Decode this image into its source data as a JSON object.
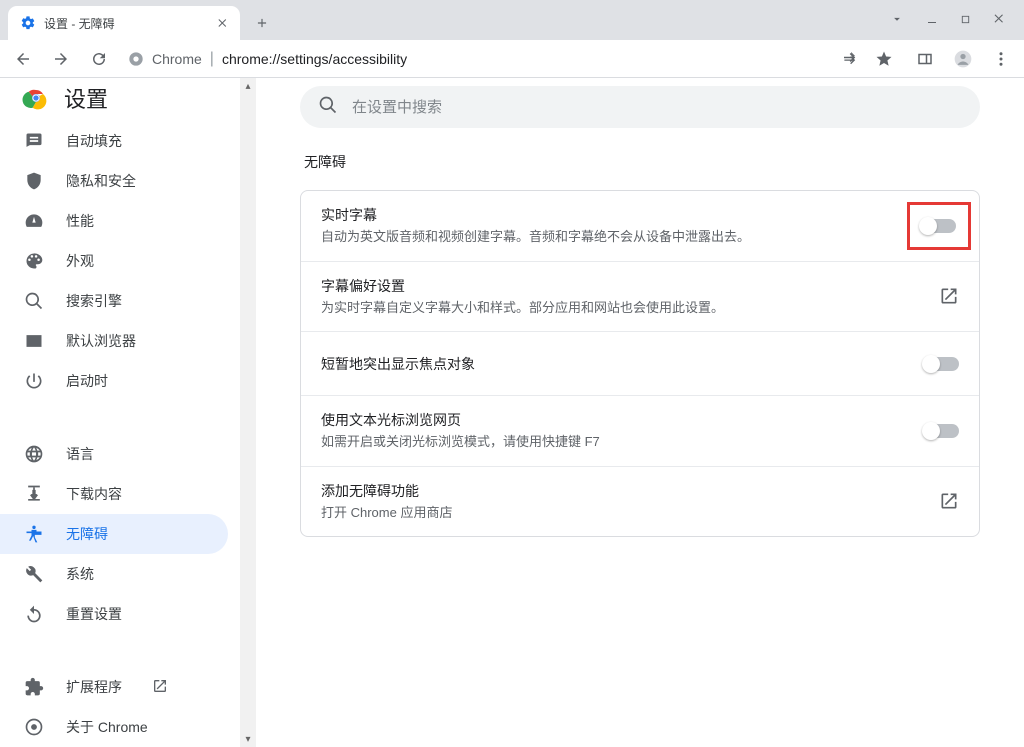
{
  "tab": {
    "title": "设置 - 无障碍"
  },
  "toolbar": {
    "chrome_label": "Chrome",
    "url": "chrome://settings/accessibility"
  },
  "brand": {
    "title": "设置"
  },
  "search": {
    "placeholder": "在设置中搜索"
  },
  "sidebar": {
    "items": [
      {
        "label": "自动填充"
      },
      {
        "label": "隐私和安全"
      },
      {
        "label": "性能"
      },
      {
        "label": "外观"
      },
      {
        "label": "搜索引擎"
      },
      {
        "label": "默认浏览器"
      },
      {
        "label": "启动时"
      },
      {
        "label": "语言"
      },
      {
        "label": "下载内容"
      },
      {
        "label": "无障碍"
      },
      {
        "label": "系统"
      },
      {
        "label": "重置设置"
      },
      {
        "label": "扩展程序"
      },
      {
        "label": "关于 Chrome"
      }
    ]
  },
  "section": {
    "title": "无障碍"
  },
  "rows": [
    {
      "primary": "实时字幕",
      "secondary": "自动为英文版音频和视频创建字幕。音频和字幕绝不会从设备中泄露出去。"
    },
    {
      "primary": "字幕偏好设置",
      "secondary": "为实时字幕自定义字幕大小和样式。部分应用和网站也会使用此设置。"
    },
    {
      "primary": "短暂地突出显示焦点对象"
    },
    {
      "primary": "使用文本光标浏览网页",
      "secondary": "如需开启或关闭光标浏览模式，请使用快捷键 F7"
    },
    {
      "primary": "添加无障碍功能",
      "secondary": "打开 Chrome 应用商店"
    }
  ]
}
